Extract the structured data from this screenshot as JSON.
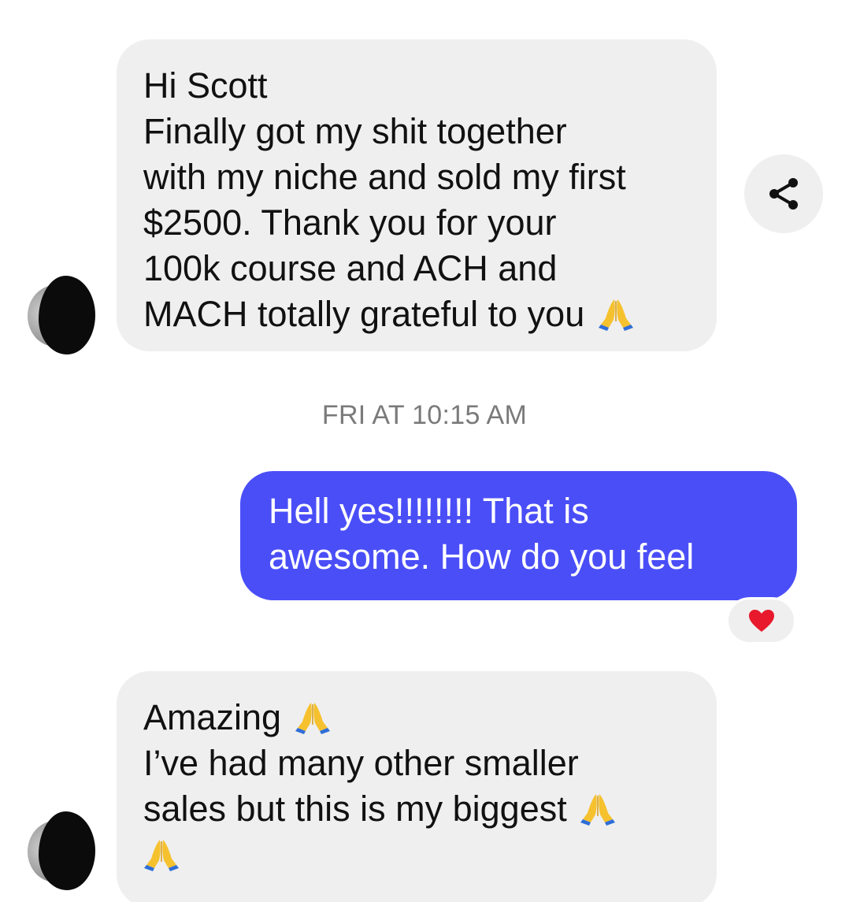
{
  "messages": {
    "first": {
      "lines": [
        "Hi Scott",
        "Finally got my shit together",
        "with my niche and sold my first",
        "$2500. Thank you for your",
        "100k course and ACH and",
        "MACH totally grateful to you"
      ]
    },
    "timestamp": "FRI AT 10:15 AM",
    "reply": {
      "lines": [
        "Hell yes!!!!!!!! That is",
        "awesome. How do you feel"
      ]
    },
    "second": {
      "lines": [
        "Amazing",
        "I’ve had many other smaller",
        "sales but this is my biggest"
      ]
    }
  },
  "icons": {
    "share": "share-icon",
    "reaction": "heart-icon",
    "emoji": "folded-hands-emoji"
  },
  "colors": {
    "incoming_bubble": "#efefef",
    "outgoing_bubble": "#4a4ef7",
    "heart": "#e8192c"
  }
}
